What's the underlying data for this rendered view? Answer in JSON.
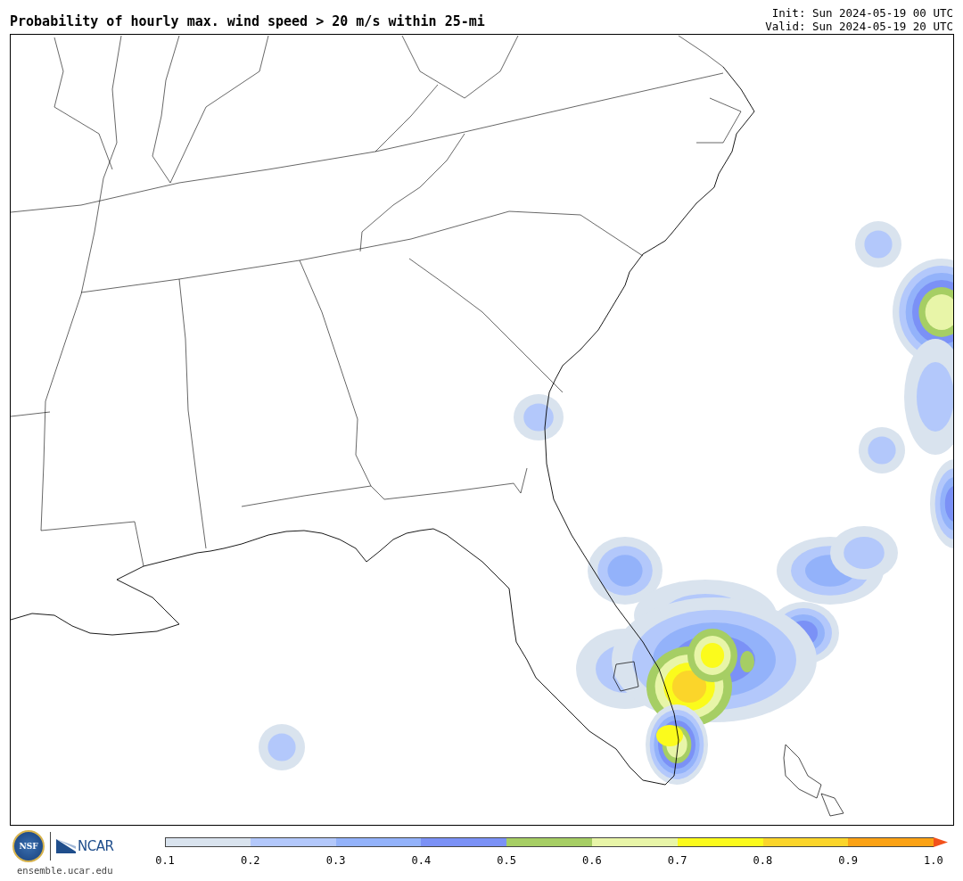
{
  "title": "Probability of hourly max. wind speed > 20 m/s within 25-mi",
  "init": "Init: Sun 2024-05-19 00 UTC",
  "valid": "Valid: Sun 2024-05-19 20 UTC",
  "logos": {
    "nsf": "NSF",
    "ncar": "NCAR",
    "site": "ensemble.ucar.edu"
  },
  "colorbar": {
    "bins": [
      {
        "color": "#d9e3ee"
      },
      {
        "color": "#b3c8fb"
      },
      {
        "color": "#93b2fa"
      },
      {
        "color": "#7b91f6"
      },
      {
        "color": "#a6ce64"
      },
      {
        "color": "#e8f5a8"
      },
      {
        "color": "#fbfb1c"
      },
      {
        "color": "#fbd52a"
      },
      {
        "color": "#fba215"
      }
    ],
    "extend_arrow": {
      "color": "#f2511b"
    },
    "ticks": [
      "0.1",
      "0.2",
      "0.3",
      "0.4",
      "0.5",
      "0.6",
      "0.7",
      "0.8",
      "0.9",
      "1.0"
    ]
  }
}
